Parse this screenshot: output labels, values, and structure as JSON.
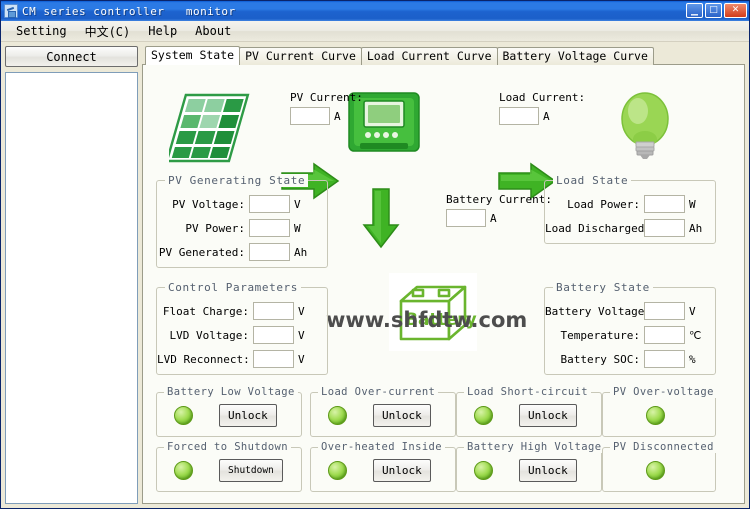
{
  "window": {
    "title": "CM series controller   monitor",
    "icon": "app-icon",
    "buttons": {
      "minimize": "_",
      "maximize": "□",
      "close": "✕"
    }
  },
  "menu": {
    "items": [
      {
        "label": "Setting"
      },
      {
        "label": "中文(C)"
      },
      {
        "label": "Help"
      },
      {
        "label": "About"
      }
    ]
  },
  "left_panel": {
    "connect_label": "Connect",
    "log_items": []
  },
  "tabs": [
    {
      "label": "System State",
      "active": true
    },
    {
      "label": "PV Current Curve",
      "active": false
    },
    {
      "label": "Load Current Curve",
      "active": false
    },
    {
      "label": "Battery Voltage Curve",
      "active": false
    }
  ],
  "watermark": "www.shfdtw.com",
  "top_meters": {
    "pv_current": {
      "label": "PV Current:",
      "value": "",
      "unit": "A"
    },
    "load_current": {
      "label": "Load Current:",
      "value": "",
      "unit": "A"
    },
    "battery_current": {
      "label": "Battery Current:",
      "value": "",
      "unit": "A"
    }
  },
  "icons": {
    "solar_panel": "solar-panel-icon",
    "controller": "controller-icon",
    "bulb": "light-bulb-icon",
    "battery": "battery-icon",
    "battery_text": "Battery",
    "arrow_pv_to_controller": "green-arrow-right-icon",
    "arrow_controller_to_load": "green-arrow-right-icon",
    "arrow_controller_to_battery": "green-arrow-down-icon"
  },
  "groups": {
    "pv_generating_state": {
      "title": "PV Generating State",
      "fields": [
        {
          "label": "PV Voltage:",
          "value": "",
          "unit": "V"
        },
        {
          "label": "PV Power:",
          "value": "",
          "unit": "W"
        },
        {
          "label": "PV Generated:",
          "value": "",
          "unit": "Ah"
        }
      ]
    },
    "load_state": {
      "title": "Load State",
      "fields": [
        {
          "label": "Load Power:",
          "value": "",
          "unit": "W"
        },
        {
          "label": "Load Discharged:",
          "value": "",
          "unit": "Ah"
        }
      ]
    },
    "control_parameters": {
      "title": "Control Parameters",
      "fields": [
        {
          "label": "Float Charge:",
          "value": "",
          "unit": "V"
        },
        {
          "label": "LVD Voltage:",
          "value": "",
          "unit": "V"
        },
        {
          "label": "LVD Reconnect:",
          "value": "",
          "unit": "V"
        }
      ]
    },
    "battery_state": {
      "title": "Battery State",
      "fields": [
        {
          "label": "Battery Voltage:",
          "value": "",
          "unit": "V"
        },
        {
          "label": "Temperature:",
          "value": "",
          "unit": "℃"
        },
        {
          "label": "Battery SOC:",
          "value": "",
          "unit": "%"
        }
      ]
    }
  },
  "alarms": [
    {
      "title": "Battery Low Voltage",
      "led": "green",
      "button": "Unlock"
    },
    {
      "title": "Load Over-current",
      "led": "green",
      "button": "Unlock"
    },
    {
      "title": "Load Short-circuit",
      "led": "green",
      "button": "Unlock"
    },
    {
      "title": "PV Over-voltage",
      "led": "green",
      "button": null
    },
    {
      "title": "Forced to Shutdown",
      "led": "green",
      "button": "Shutdown"
    },
    {
      "title": "Over-heated Inside",
      "led": "green",
      "button": "Unlock"
    },
    {
      "title": "Battery High Voltage",
      "led": "green",
      "button": "Unlock"
    },
    {
      "title": "PV Disconnected",
      "led": "green",
      "button": null
    }
  ],
  "colors": {
    "title_bar": "#1b5fc9",
    "accent_green": "#4fb81f",
    "led_green": "#8fd43e",
    "group_title": "#556070",
    "panel_bg": "#ece9d8",
    "tab_bg": "#fbfcf7"
  }
}
